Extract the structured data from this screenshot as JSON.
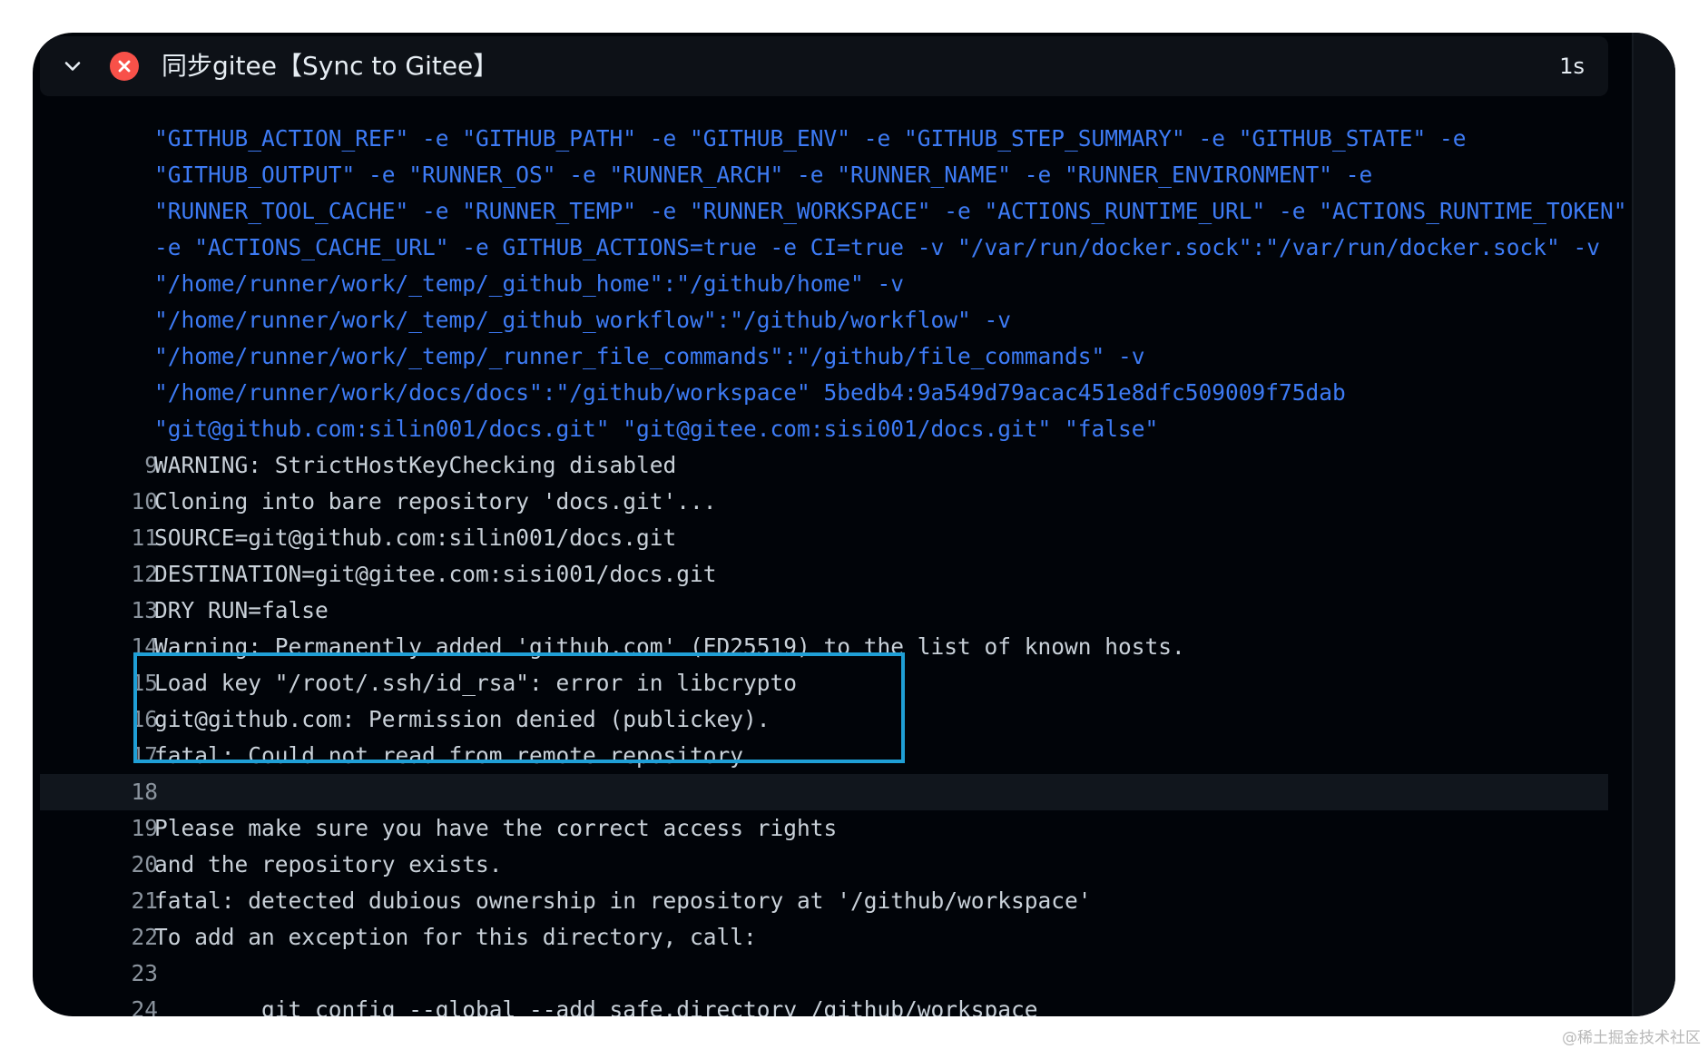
{
  "header": {
    "title": "同步gitee【Sync to Gitee】",
    "duration": "1s",
    "status": "failed",
    "status_color": "#f85149",
    "toggle_icon": "chevron-down-icon"
  },
  "command_lines": [
    "\"GITHUB_ACTION_REF\" -e \"GITHUB_PATH\" -e \"GITHUB_ENV\" -e \"GITHUB_STEP_SUMMARY\" -e \"GITHUB_STATE\" -e",
    "\"GITHUB_OUTPUT\" -e \"RUNNER_OS\" -e \"RUNNER_ARCH\" -e \"RUNNER_NAME\" -e \"RUNNER_ENVIRONMENT\" -e",
    "\"RUNNER_TOOL_CACHE\" -e \"RUNNER_TEMP\" -e \"RUNNER_WORKSPACE\" -e \"ACTIONS_RUNTIME_URL\" -e \"ACTIONS_RUNTIME_TOKEN\"",
    "-e \"ACTIONS_CACHE_URL\" -e GITHUB_ACTIONS=true -e CI=true -v \"/var/run/docker.sock\":\"/var/run/docker.sock\" -v",
    "\"/home/runner/work/_temp/_github_home\":\"/github/home\" -v",
    "\"/home/runner/work/_temp/_github_workflow\":\"/github/workflow\" -v",
    "\"/home/runner/work/_temp/_runner_file_commands\":\"/github/file_commands\" -v",
    "\"/home/runner/work/docs/docs\":\"/github/workspace\" 5bedb4:9a549d79acac451e8dfc509009f75dab",
    "\"git@github.com:silin001/docs.git\" \"git@gitee.com:sisi001/docs.git\" \"false\""
  ],
  "log_lines": [
    {
      "num": "9",
      "text": "WARNING: StrictHostKeyChecking disabled"
    },
    {
      "num": "10",
      "text": "Cloning into bare repository 'docs.git'..."
    },
    {
      "num": "11",
      "text": "SOURCE=git@github.com:silin001/docs.git"
    },
    {
      "num": "12",
      "text": "DESTINATION=git@gitee.com:sisi001/docs.git"
    },
    {
      "num": "13",
      "text": "DRY RUN=false"
    },
    {
      "num": "14",
      "text": "Warning: Permanently added 'github.com' (ED25519) to the list of known hosts."
    },
    {
      "num": "15",
      "text": "Load key \"/root/.ssh/id_rsa\": error in libcrypto"
    },
    {
      "num": "16",
      "text": "git@github.com: Permission denied (publickey)."
    },
    {
      "num": "17",
      "text": "fatal: Could not read from remote repository."
    },
    {
      "num": "18",
      "text": ""
    },
    {
      "num": "19",
      "text": "Please make sure you have the correct access rights"
    },
    {
      "num": "20",
      "text": "and the repository exists."
    },
    {
      "num": "21",
      "text": "fatal: detected dubious ownership in repository at '/github/workspace'"
    },
    {
      "num": "22",
      "text": "To add an exception for this directory, call:"
    },
    {
      "num": "23",
      "text": ""
    },
    {
      "num": "24",
      "text": "        git config --global --add safe.directory /github/workspace"
    }
  ],
  "highlighted_line": "18",
  "watermark": "@稀土掘金技术社区",
  "colors": {
    "background": "#010409",
    "command_text": "#3d7bf5",
    "log_text": "#c9d1d9",
    "annotation_box": "#1f9fd6"
  }
}
